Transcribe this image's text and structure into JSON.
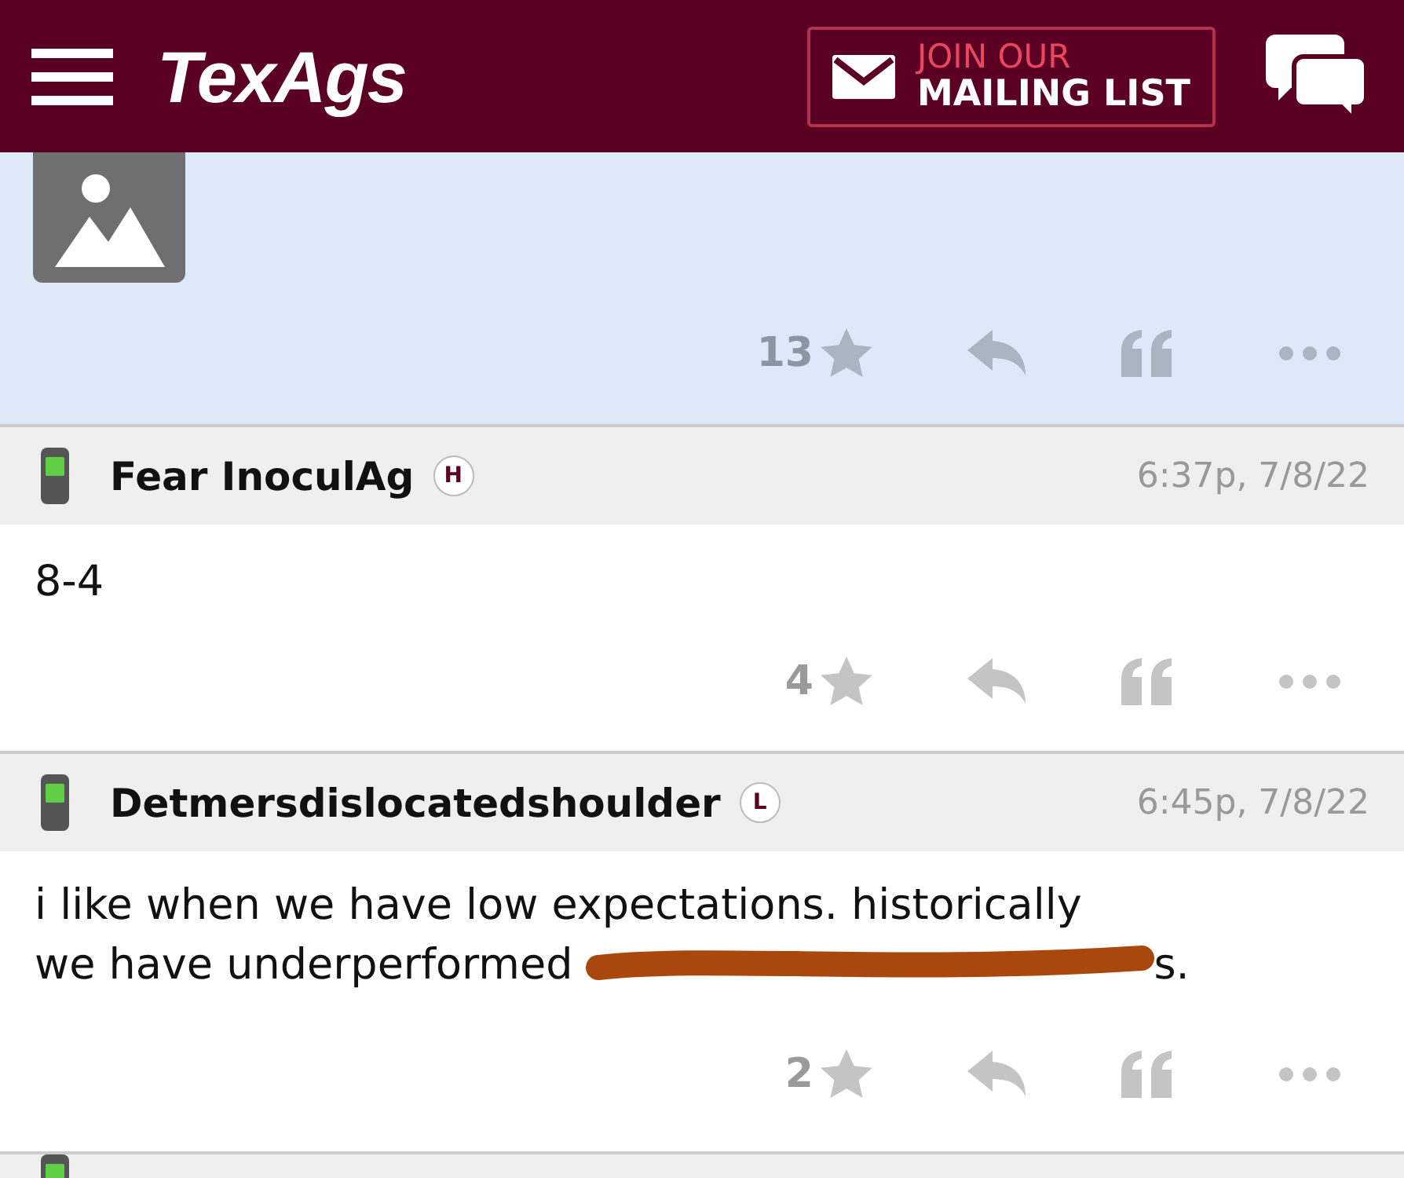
{
  "header": {
    "logo": "TexAgs",
    "mailing": {
      "line1": "JOIN OUR",
      "line2": "MAILING LIST"
    }
  },
  "posts": [
    {
      "likes": "13"
    },
    {
      "kind": "reply",
      "user": "Fear InoculAg",
      "badge": "H",
      "time": "6:37p, 7/8/22",
      "body": [
        "8-4"
      ],
      "likes": "4"
    },
    {
      "kind": "reply",
      "user": "Detmersdislocatedshoulder",
      "badge": "L",
      "time": "6:45p, 7/8/22",
      "body": [
        "i like when we have low expectations. historically",
        "we have underperformed",
        "s."
      ],
      "likes": "2"
    },
    {
      "kind": "stub"
    }
  ]
}
